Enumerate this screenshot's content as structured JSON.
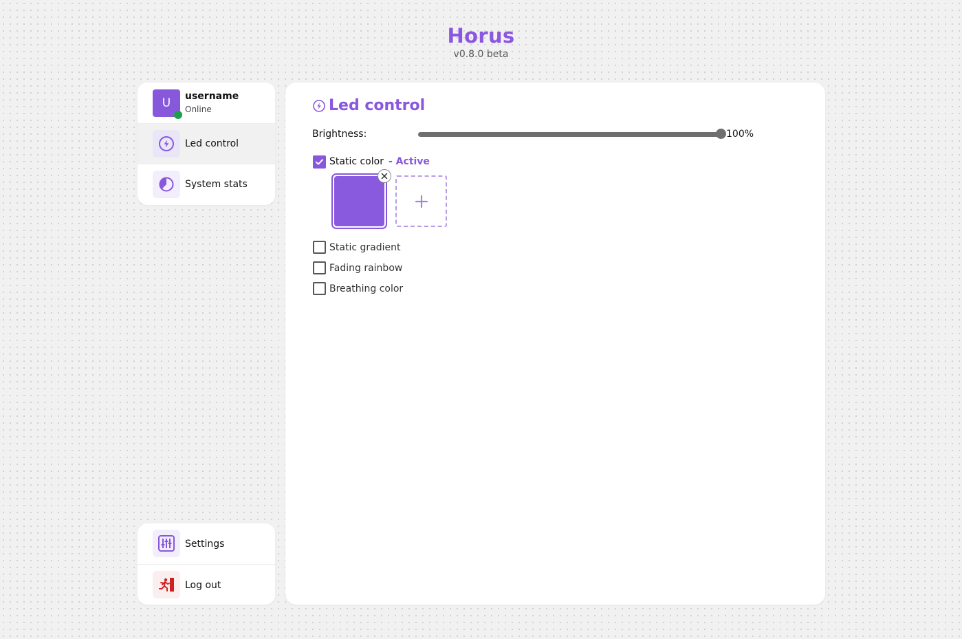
{
  "app": {
    "title": "Horus",
    "version": "v0.8.0 beta"
  },
  "user": {
    "initial": "U",
    "name": "username",
    "status": "Online"
  },
  "nav": {
    "items": [
      {
        "label": "Led control",
        "icon": "lightning-circle-icon",
        "active": true
      },
      {
        "label": "System stats",
        "icon": "pie-chart-icon",
        "active": false
      }
    ],
    "bottom": [
      {
        "label": "Settings",
        "icon": "sliders-icon"
      },
      {
        "label": "Log out",
        "icon": "exit-runner-icon"
      }
    ]
  },
  "main": {
    "title": "Led control",
    "brightness": {
      "label": "Brightness:",
      "value": 100,
      "display": "100%"
    },
    "modes": [
      {
        "label": "Static color",
        "checked": true,
        "tag": "- Active"
      },
      {
        "label": "Static gradient",
        "checked": false
      },
      {
        "label": "Fading rainbow",
        "checked": false
      },
      {
        "label": "Breathing color",
        "checked": false
      }
    ],
    "colors": [
      "#8a5ade"
    ],
    "add_symbol": "+"
  },
  "theme": {
    "accent": "#8a57de",
    "online": "#1ea04a",
    "danger": "#d11f1f"
  }
}
